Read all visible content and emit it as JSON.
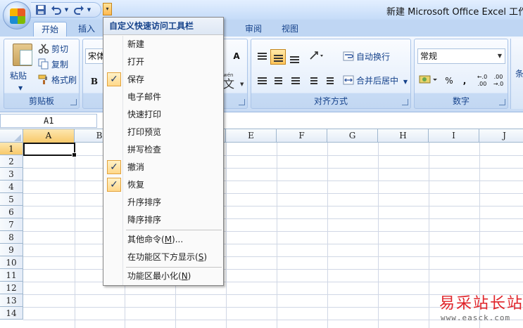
{
  "window": {
    "title": "新建 Microsoft Office Excel 工作表"
  },
  "quick_access": {
    "save_icon": "save-icon",
    "undo_icon": "undo-icon",
    "redo_icon": "redo-icon",
    "customize_icon": "chevron-down-icon"
  },
  "tabs": [
    {
      "label": "开始",
      "active": true
    },
    {
      "label": "插入",
      "active": false
    },
    {
      "label": "审阅",
      "active": false
    },
    {
      "label": "视图",
      "active": false
    }
  ],
  "ribbon": {
    "clipboard": {
      "paste_label": "粘贴",
      "cut_label": "剪切",
      "copy_label": "复制",
      "format_painter_label": "格式刷",
      "group_label": "剪贴板"
    },
    "font": {
      "font_name": "宋体",
      "bold_label": "B",
      "font_size_up": "A",
      "font_size_down": "A",
      "phonetic_label": "wén",
      "phonetic_char": "文"
    },
    "alignment": {
      "wrap_text_label": "自动换行",
      "merge_center_label": "合并后居中",
      "group_label": "对齐方式"
    },
    "number": {
      "format_value": "常规",
      "percent_label": "%",
      "comma_label": ",",
      "increase_decimal": "←.0 .00",
      "decrease_decimal": ".00 →.0",
      "group_label": "数字"
    },
    "styles": {
      "conditional_label": "条"
    }
  },
  "formula_bar": {
    "name_box": "A1"
  },
  "grid": {
    "columns": [
      "A",
      "B",
      "C",
      "D",
      "E",
      "F",
      "G",
      "H",
      "I",
      "J"
    ],
    "rows": [
      "1",
      "2",
      "3",
      "4",
      "5",
      "6",
      "7",
      "8",
      "9",
      "10",
      "11",
      "12",
      "13",
      "14"
    ],
    "selected_cell": "A1"
  },
  "qat_menu": {
    "header": "自定义快速访问工具栏",
    "items": [
      {
        "label": "新建",
        "checked": false
      },
      {
        "label": "打开",
        "checked": false
      },
      {
        "label": "保存",
        "checked": true
      },
      {
        "label": "电子邮件",
        "checked": false
      },
      {
        "label": "快速打印",
        "checked": false
      },
      {
        "label": "打印预览",
        "checked": false
      },
      {
        "label": "拼写检查",
        "checked": false
      },
      {
        "label": "撤消",
        "checked": true
      },
      {
        "label": "恢复",
        "checked": true
      },
      {
        "label": "升序排序",
        "checked": false
      },
      {
        "label": "降序排序",
        "checked": false
      }
    ],
    "more_commands": {
      "label": "其他命令(",
      "mnemonic": "M",
      "suffix": ")..."
    },
    "show_below": {
      "label": "在功能区下方显示(",
      "mnemonic": "S",
      "suffix": ")"
    },
    "minimize": {
      "label": "功能区最小化(",
      "mnemonic": "N",
      "suffix": ")"
    },
    "check_mark": "✓"
  },
  "watermark": {
    "text": "易采站长站",
    "url": "www.easck.com"
  }
}
